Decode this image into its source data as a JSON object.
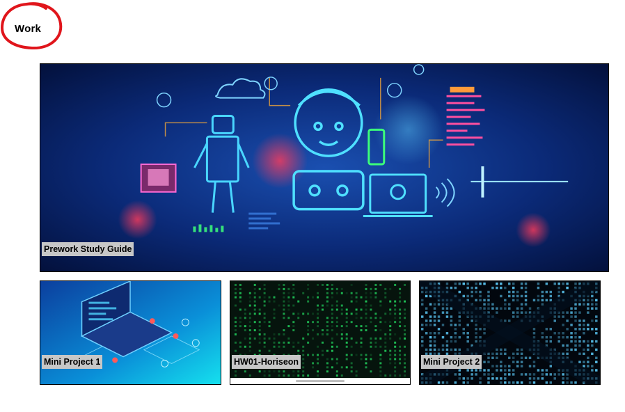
{
  "section": {
    "title": "Work",
    "circle_color": "#e0151b"
  },
  "projects": [
    {
      "label": "Prework Study Guide",
      "image": "robot-and-child-tech-illustration"
    },
    {
      "label": "Mini Project 1",
      "image": "isometric-laptop-illustration"
    },
    {
      "label": "HW01-Horiseon",
      "image": "green-binary-code-matrix"
    },
    {
      "label": "Mini Project 2",
      "image": "blue-binary-code-tunnel"
    }
  ],
  "colors": {
    "caption_bg": "#c7c7c7",
    "card_border": "#000000"
  }
}
